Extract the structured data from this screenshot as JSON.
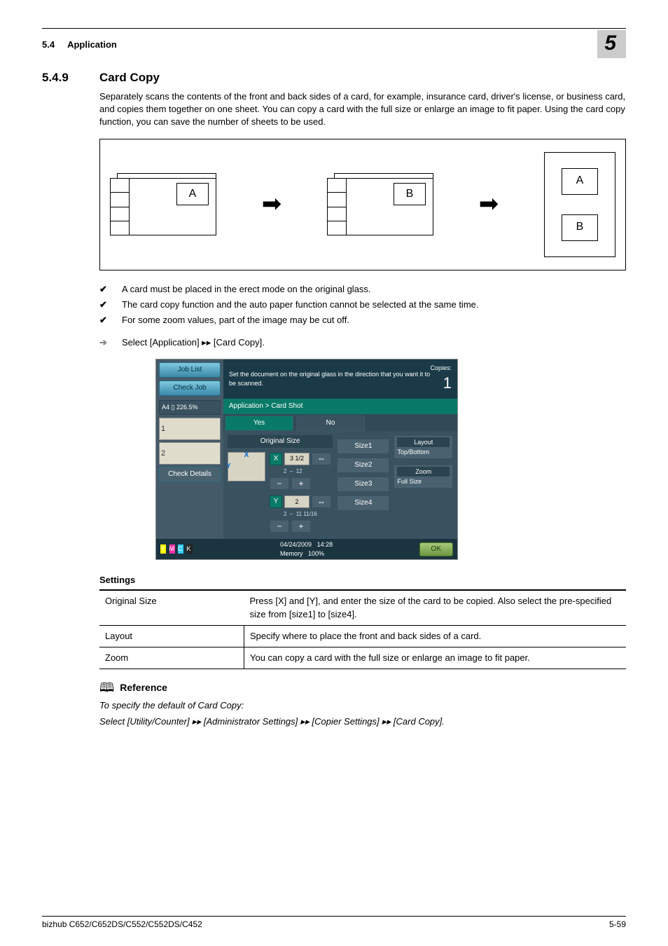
{
  "header": {
    "section_num": "5.4",
    "section_name": "Application",
    "chapter": "5"
  },
  "section": {
    "num": "5.4.9",
    "title": "Card Copy",
    "intro": "Separately scans the contents of the front and back sides of a card, for example, insurance card, driver's license, or business card, and copies them together on one sheet. You can copy a card with the full size or enlarge an image to fit paper. Using the card copy function, you can save the number of sheets to be used."
  },
  "diagram": {
    "card_a": "A",
    "card_b": "B"
  },
  "bullets": [
    "A card must be placed in the erect mode on the original glass.",
    "The card copy function and the auto paper function cannot be selected at the same time.",
    "For some zoom values, part of the image may be cut off."
  ],
  "nav_path": "Select [Application] ▸▸ [Card Copy].",
  "screenshot": {
    "sidebar": {
      "job_list": "Job List",
      "check_job": "Check Job",
      "paper": "A4 ▯  226.5%",
      "check_details": "Check Details"
    },
    "instruction": "Set the document on the original glass in the direction that you want it to be scanned.",
    "copies_label": "Copies:",
    "copies_value": "1",
    "breadcrumb": "Application > Card Shot",
    "tabs": {
      "yes": "Yes",
      "no": "No"
    },
    "original_size_label": "Original Size",
    "fields": {
      "x_label": "X",
      "x_value": "3 1/2",
      "x_range_lo": "2",
      "x_range_hi": "12",
      "y_label": "Y",
      "y_value": "2",
      "y_range_lo": "2",
      "y_range_hi": "11 11/16"
    },
    "size_buttons": [
      "Size1",
      "Size2",
      "Size3",
      "Size4"
    ],
    "layout": {
      "title": "Layout",
      "value": "Top/Bottom"
    },
    "zoom": {
      "title": "Zoom",
      "value": "Full Size"
    },
    "status": {
      "date": "04/24/2009",
      "time": "14:28",
      "memory_label": "Memory",
      "memory_value": "100%",
      "ok": "OK"
    },
    "toner": {
      "y": "Y",
      "m": "M",
      "c": "C",
      "k": "K"
    }
  },
  "table": {
    "title": "Settings",
    "rows": [
      {
        "k": "Original Size",
        "v": "Press [X] and [Y], and enter the size of the card to be copied. Also select the pre-specified size from [size1] to [size4]."
      },
      {
        "k": "Layout",
        "v": "Specify where to place the front and back sides of a card."
      },
      {
        "k": "Zoom",
        "v": "You can copy a card with the full size or enlarge an image to fit paper."
      }
    ]
  },
  "reference": {
    "title": "Reference",
    "l1": "To specify the default of Card Copy:",
    "l2": "Select [Utility/Counter] ▸▸ [Administrator Settings] ▸▸ [Copier Settings] ▸▸ [Card Copy]."
  },
  "footer": {
    "left": "bizhub C652/C652DS/C552/C552DS/C452",
    "right": "5-59"
  }
}
